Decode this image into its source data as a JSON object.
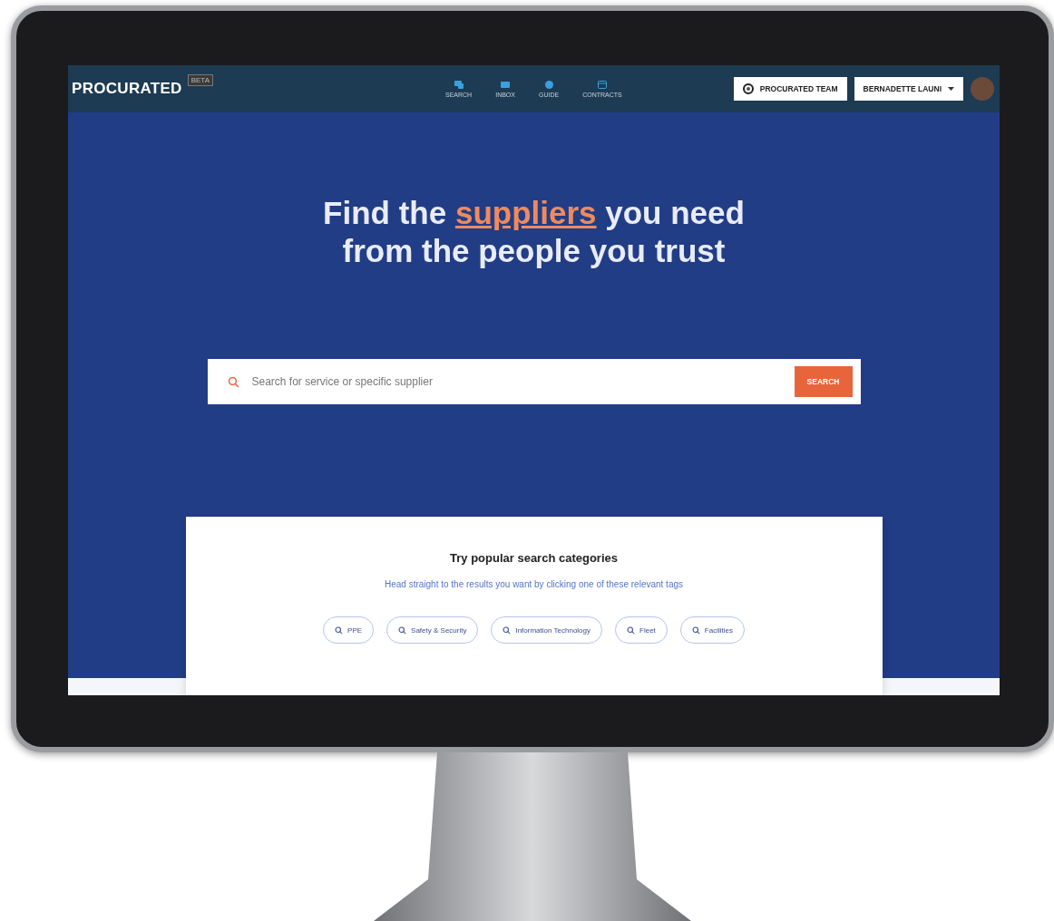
{
  "nav": {
    "logo": "PROCURATED",
    "badge": "BETA",
    "items": [
      {
        "label": "SEARCH",
        "kind": "search"
      },
      {
        "label": "INBOX",
        "kind": "inbox"
      },
      {
        "label": "GUIDE",
        "kind": "guide"
      },
      {
        "label": "CONTRACTS",
        "kind": "contracts"
      }
    ],
    "team_button": "PROCURATED TEAM",
    "user_button": "BERNADETTE LAUNI"
  },
  "hero": {
    "headline": {
      "before": "Find the",
      "highlight": "suppliers",
      "after": "you need from the people you trust"
    },
    "search": {
      "placeholder": "Search for service or specific supplier",
      "button": "SEARCH"
    }
  },
  "categories": {
    "title": "Try popular search categories",
    "subtitle": "Head straight to the results you want by clicking one of these relevant tags",
    "tags": [
      "PPE",
      "Safety & Security",
      "Information Technology",
      "Fleet",
      "Facilities"
    ]
  }
}
